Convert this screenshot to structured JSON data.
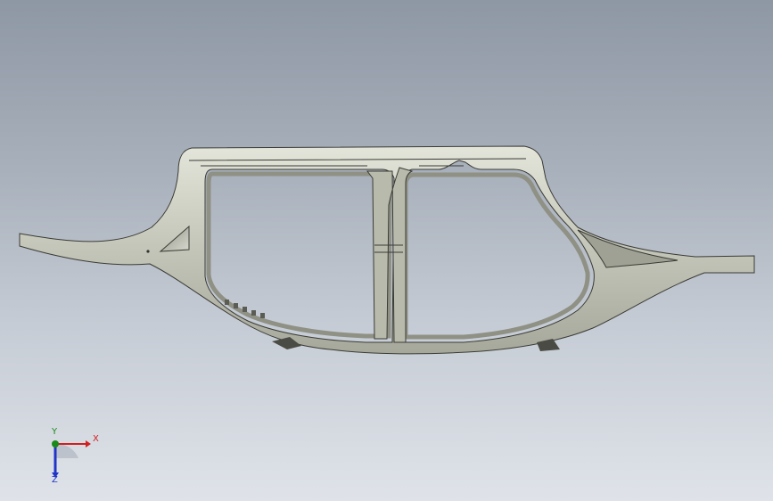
{
  "viewport": {
    "background_top": "#8e97a4",
    "background_bottom": "#dfe3e9"
  },
  "model": {
    "body_color": "#c5c7bb",
    "edge_color": "#3a3b35",
    "shadow_color": "#6f7166"
  },
  "triad": {
    "x_label": "X",
    "y_label": "Y",
    "z_label": "Z",
    "x_color": "#d21f1f",
    "y_color": "#1a8a1a",
    "z_color": "#2035c8"
  }
}
